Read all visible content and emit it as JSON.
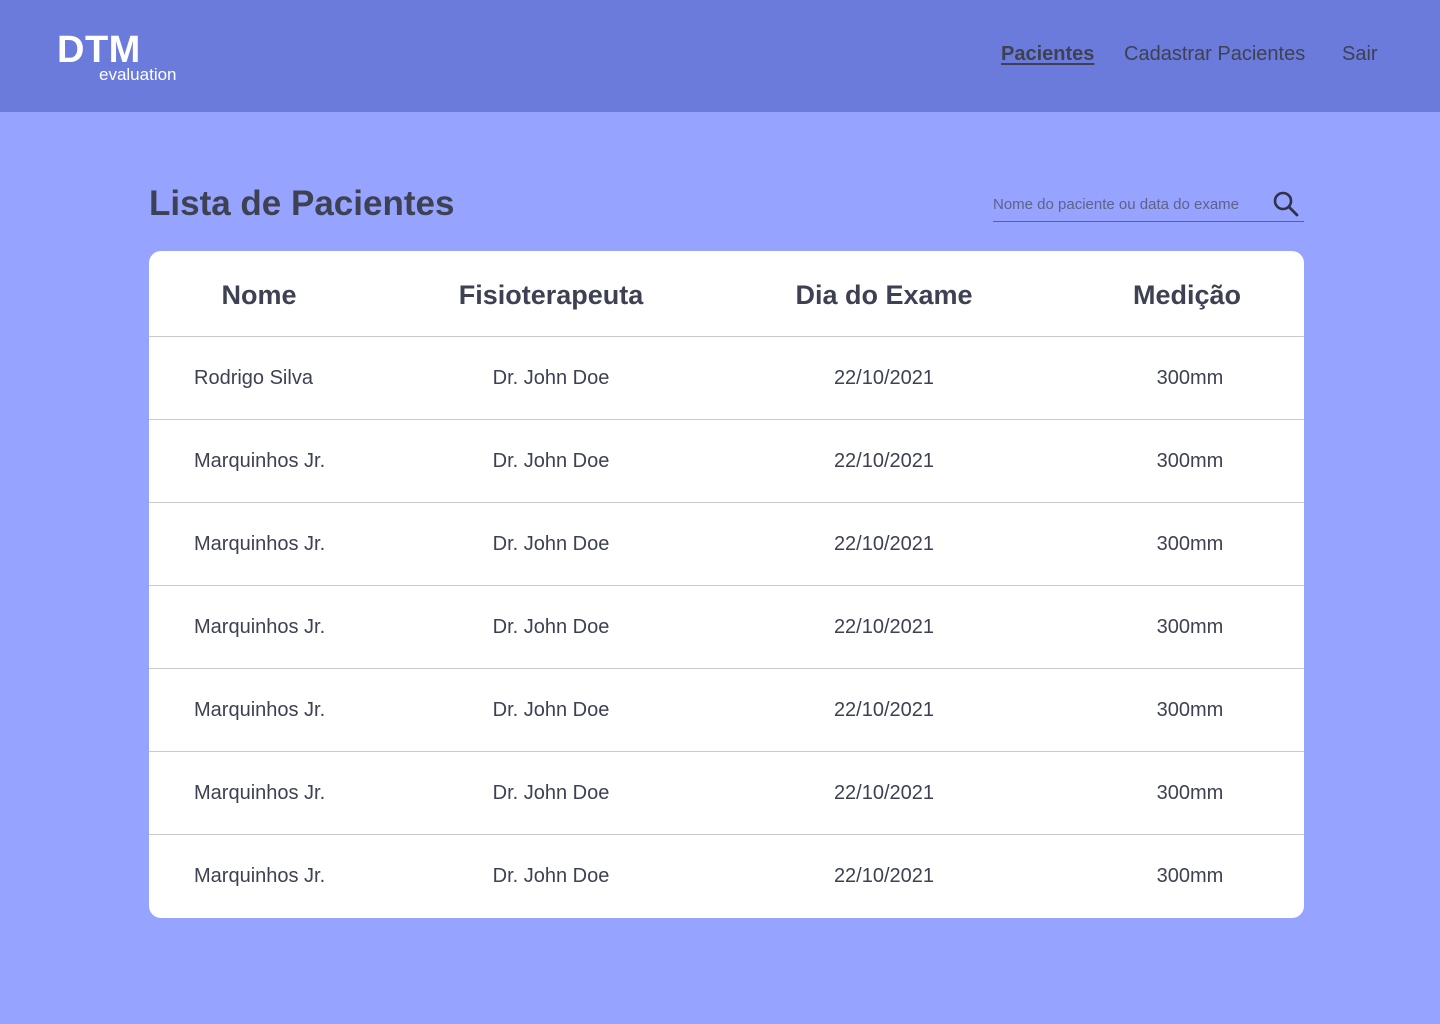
{
  "header": {
    "logo_title": "DTM",
    "logo_subtitle": "evaluation",
    "nav": [
      {
        "label": "Pacientes",
        "active": true
      },
      {
        "label": "Cadastrar Pacientes",
        "active": false
      },
      {
        "label": "Sair",
        "active": false
      }
    ]
  },
  "main": {
    "title": "Lista de Pacientes",
    "search": {
      "placeholder": "Nome do paciente ou data do exame",
      "value": "",
      "icon": "search-icon"
    }
  },
  "table": {
    "headers": [
      "Nome",
      "Fisioterapeuta",
      "Dia do Exame",
      "Medição"
    ],
    "rows": [
      [
        "Rodrigo Silva",
        "Dr. John Doe",
        "22/10/2021",
        "300mm"
      ],
      [
        "Marquinhos Jr.",
        "Dr. John Doe",
        "22/10/2021",
        "300mm"
      ],
      [
        "Marquinhos Jr.",
        "Dr. John Doe",
        "22/10/2021",
        "300mm"
      ],
      [
        "Marquinhos Jr.",
        "Dr. John Doe",
        "22/10/2021",
        "300mm"
      ],
      [
        "Marquinhos Jr.",
        "Dr. John Doe",
        "22/10/2021",
        "300mm"
      ],
      [
        "Marquinhos Jr.",
        "Dr. John Doe",
        "22/10/2021",
        "300mm"
      ],
      [
        "Marquinhos Jr.",
        "Dr. John Doe",
        "22/10/2021",
        "300mm"
      ]
    ]
  },
  "colors": {
    "header_bg": "#6b7bdc",
    "page_bg": "#96a3ff",
    "card_bg": "#ffffff",
    "text": "#3d4152"
  }
}
